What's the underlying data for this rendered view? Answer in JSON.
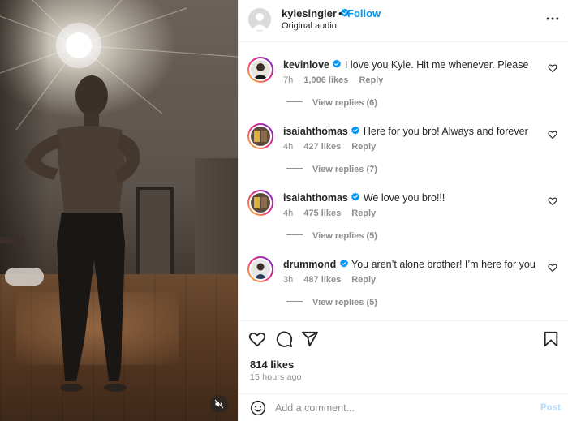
{
  "header": {
    "username": "kylesingler",
    "separator": "•",
    "follow_label": "Follow",
    "subtitle": "Original audio"
  },
  "comments": [
    {
      "user": "kevinlove",
      "text": "I love you Kyle. Hit me whenever. Please",
      "time": "7h",
      "likes": "1,006 likes",
      "reply": "Reply",
      "replies": "View replies (6)"
    },
    {
      "user": "isaiahthomas",
      "text": "Here for you bro! Always and forever",
      "time": "4h",
      "likes": "427 likes",
      "reply": "Reply",
      "replies": "View replies (7)"
    },
    {
      "user": "isaiahthomas",
      "text": "We love you bro!!!",
      "time": "4h",
      "likes": "475 likes",
      "reply": "Reply",
      "replies": "View replies (5)"
    },
    {
      "user": "drummond",
      "text": "You aren’t alone brother! I’m here for you",
      "time": "3h",
      "likes": "487 likes",
      "reply": "Reply",
      "replies": "View replies (5)"
    }
  ],
  "post": {
    "likes": "814 likes",
    "time_ago": "15 hours ago"
  },
  "add_comment": {
    "placeholder": "Add a comment...",
    "post_label": "Post"
  },
  "icons": {
    "verified": "verified-badge-icon",
    "more": "more-options-icon",
    "heart": "heart-icon",
    "comment": "comment-icon",
    "share": "share-icon",
    "bookmark": "bookmark-icon",
    "emoji": "emoji-icon",
    "mute": "muted-speaker-icon"
  },
  "colors": {
    "accent": "#0095f6",
    "verified": "#0095f6",
    "text": "#262626",
    "muted": "#8e8e8e",
    "post_disabled": "#b3dbff"
  }
}
